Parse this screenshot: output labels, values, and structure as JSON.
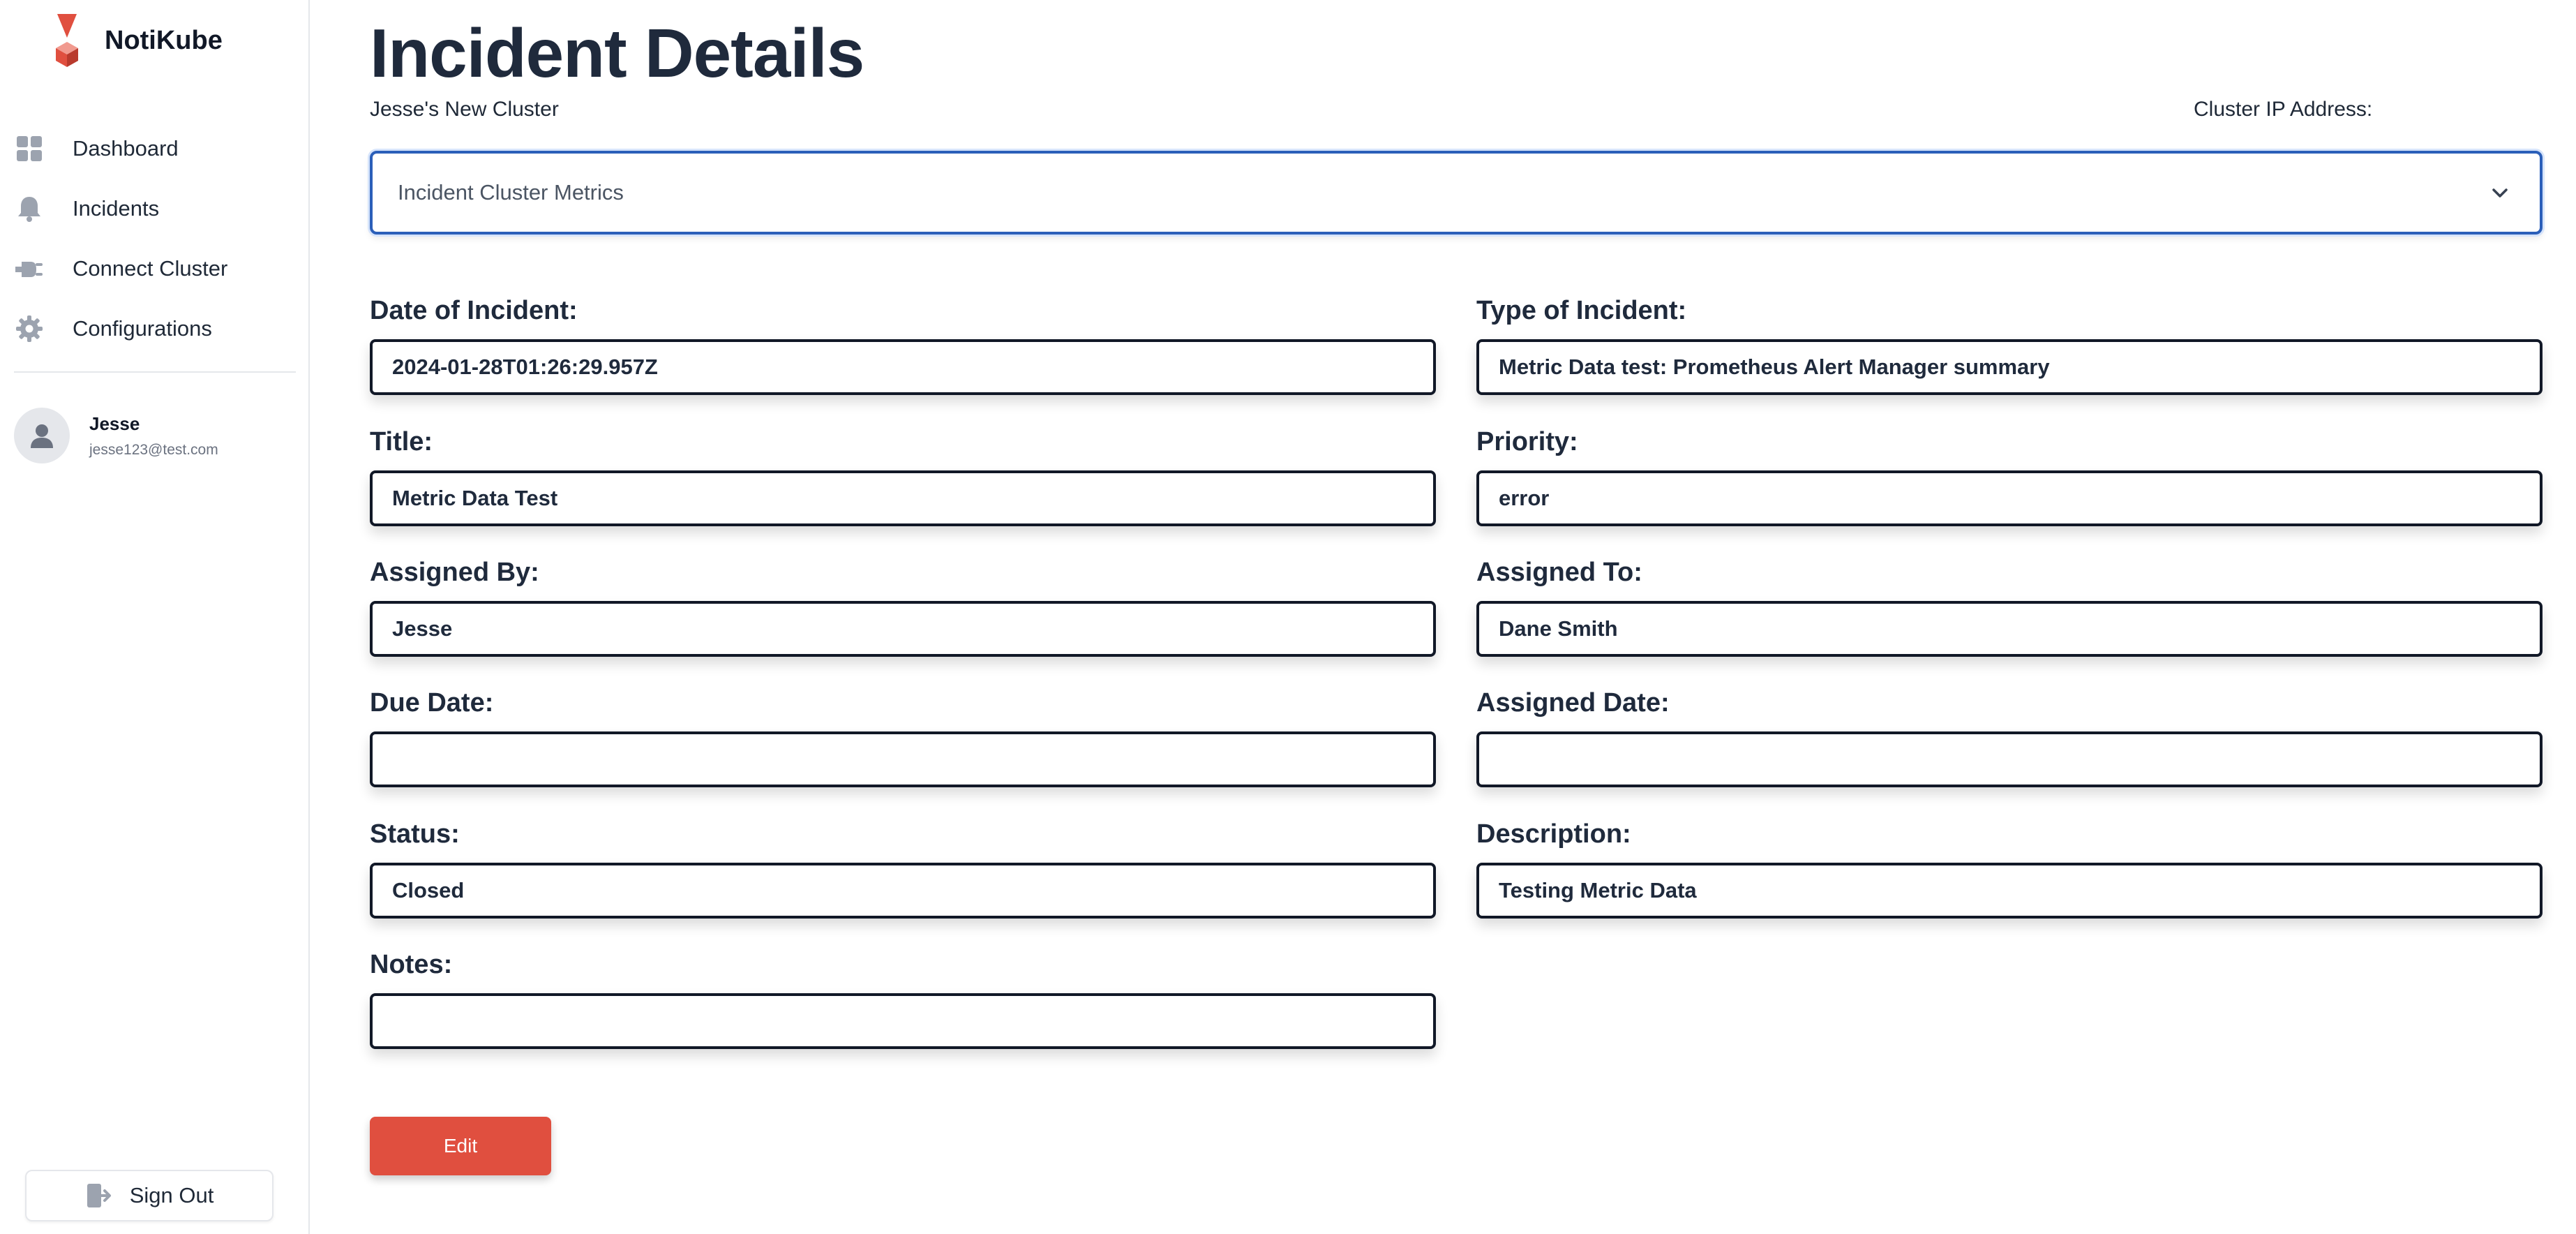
{
  "app": {
    "name": "NotiKube",
    "logo_icon": "notikube-logo-icon",
    "brand_color": "#e04f3f"
  },
  "sidebar": {
    "items": [
      {
        "label": "Dashboard",
        "icon": "dashboard-grid-icon"
      },
      {
        "label": "Incidents",
        "icon": "bell-icon"
      },
      {
        "label": "Connect Cluster",
        "icon": "plug-icon"
      },
      {
        "label": "Configurations",
        "icon": "gear-icon"
      }
    ],
    "user": {
      "name": "Jesse",
      "email": "jesse123@test.com",
      "avatar_icon": "user-avatar-icon"
    },
    "sign_out_label": "Sign Out"
  },
  "header": {
    "title": "Incident Details",
    "cluster_name": "Jesse's New Cluster",
    "cluster_ip_label": "Cluster IP Address:"
  },
  "metrics_select": {
    "label": "Incident Cluster Metrics",
    "icon": "chevron-down-icon",
    "focus_color": "#2b5fb9"
  },
  "fields": {
    "date_of_incident": {
      "label": "Date of Incident:",
      "value": "2024-01-28T01:26:29.957Z"
    },
    "type_of_incident": {
      "label": "Type of Incident:",
      "value": "Metric Data test: Prometheus Alert Manager summary"
    },
    "title": {
      "label": "Title:",
      "value": "Metric Data Test"
    },
    "priority": {
      "label": "Priority:",
      "value": "error"
    },
    "assigned_by": {
      "label": "Assigned By:",
      "value": "Jesse"
    },
    "assigned_to": {
      "label": "Assigned To:",
      "value": "Dane Smith"
    },
    "due_date": {
      "label": "Due Date:",
      "value": ""
    },
    "assigned_date": {
      "label": "Assigned Date:",
      "value": ""
    },
    "status": {
      "label": "Status:",
      "value": "Closed"
    },
    "description": {
      "label": "Description:",
      "value": "Testing Metric Data"
    },
    "notes": {
      "label": "Notes:",
      "value": ""
    }
  },
  "actions": {
    "edit_label": "Edit"
  }
}
